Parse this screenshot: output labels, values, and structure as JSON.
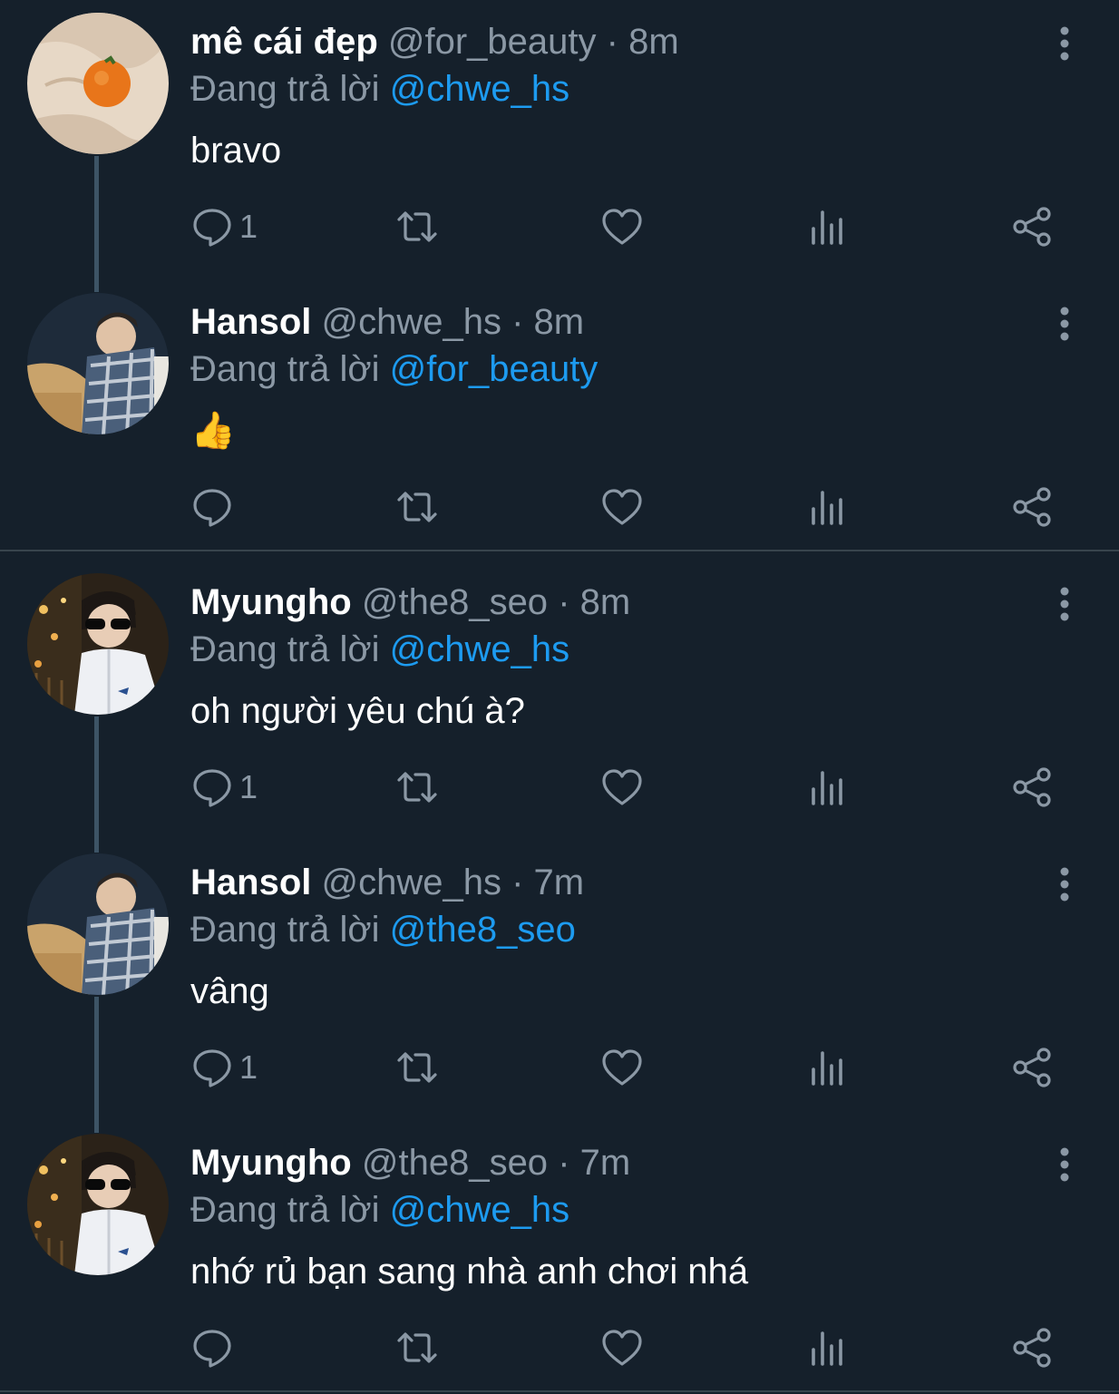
{
  "tweets": [
    {
      "display_name": "mê cái đẹp",
      "handle": "@for_beauty",
      "separator": "·",
      "time": "8m",
      "reply_prefix": "Đang trả lời",
      "reply_to": "@chwe_hs",
      "text": "bravo",
      "reply_count": "1",
      "avatar": "orange-on-cloth"
    },
    {
      "display_name": "Hansol",
      "handle": "@chwe_hs",
      "separator": "·",
      "time": "8m",
      "reply_prefix": "Đang trả lời",
      "reply_to": "@for_beauty",
      "text": "👍",
      "reply_count": "",
      "avatar": "man-in-plaid-scarf"
    },
    {
      "display_name": "Myungho",
      "handle": "@the8_seo",
      "separator": "·",
      "time": "8m",
      "reply_prefix": "Đang trả lời",
      "reply_to": "@chwe_hs",
      "text": "oh người yêu chú à?",
      "reply_count": "1",
      "avatar": "man-in-sunglasses"
    },
    {
      "display_name": "Hansol",
      "handle": "@chwe_hs",
      "separator": "·",
      "time": "7m",
      "reply_prefix": "Đang trả lời",
      "reply_to": "@the8_seo",
      "text": "vâng",
      "reply_count": "1",
      "avatar": "man-in-plaid-scarf"
    },
    {
      "display_name": "Myungho",
      "handle": "@the8_seo",
      "separator": "·",
      "time": "7m",
      "reply_prefix": "Đang trả lời",
      "reply_to": "@chwe_hs",
      "text": "nhớ rủ bạn sang nhà anh chơi nhá",
      "reply_count": "",
      "avatar": "man-in-sunglasses"
    }
  ],
  "icons": {
    "reply": "reply-icon",
    "retweet": "retweet-icon",
    "like": "heart-icon",
    "analytics": "analytics-icon",
    "share": "share-icon",
    "more": "more-vertical-icon"
  },
  "colors": {
    "background": "#15202b",
    "mention": "#1d9bf0",
    "secondary_text": "#8b98a5",
    "divider": "#38444d",
    "thread_line": "#3d5466"
  }
}
